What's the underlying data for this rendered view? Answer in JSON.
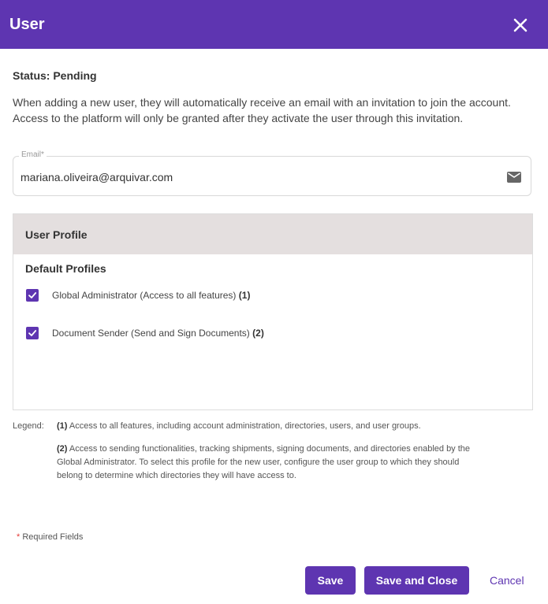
{
  "dialog": {
    "title": "User",
    "close_icon": "close-icon"
  },
  "status": {
    "label": "Status:",
    "value": "Pending"
  },
  "intro": {
    "line1": "When adding a new user, they will automatically receive an email with an invitation to join the account.",
    "line2": "Access to the platform will only be granted after they activate the user through this invitation."
  },
  "email": {
    "label": "Email*",
    "value": "mariana.oliveira@arquivar.com",
    "icon": "mail-icon"
  },
  "profiles": {
    "header": "User Profile",
    "subtitle": "Default Profiles",
    "items": [
      {
        "label": "Global Administrator (Access to all features)",
        "ref": "(1)",
        "checked": true
      },
      {
        "label": "Document Sender (Send and Sign Documents)",
        "ref": "(2)",
        "checked": true
      }
    ]
  },
  "legend": {
    "title": "Legend:",
    "items": [
      {
        "num": "(1)",
        "lines": [
          "Access to all features, including account administration, directories, users, and user groups."
        ]
      },
      {
        "num": "(2)",
        "lines": [
          "Access to sending functionalities, tracking shipments, signing documents, and directories enabled by the",
          "Global Administrator. To select this profile for the new user, configure the user group to which they should",
          "belong to determine which directories they will have access to."
        ]
      }
    ]
  },
  "required": {
    "star": "*",
    "text": "Required Fields"
  },
  "actions": {
    "save": "Save",
    "save_close": "Save and Close",
    "cancel": "Cancel"
  },
  "colors": {
    "primary": "#5e35b1",
    "profile_header_bg": "#e4dfdf",
    "required_star": "#e53935"
  }
}
